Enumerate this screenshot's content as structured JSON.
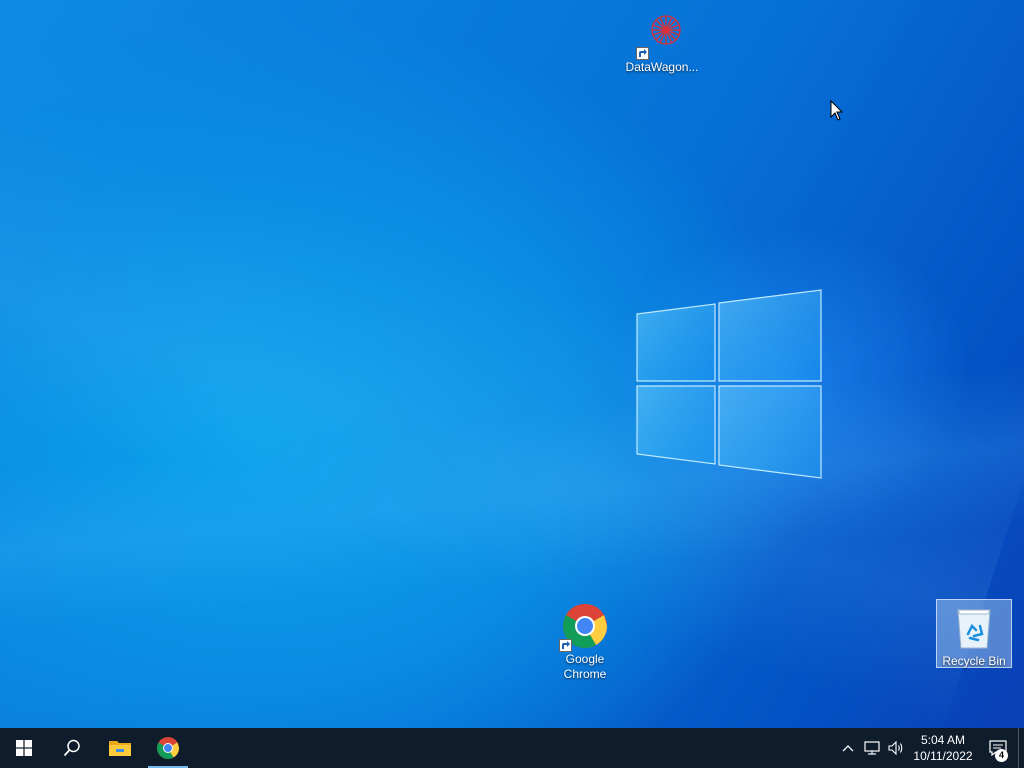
{
  "desktop": {
    "icons": {
      "datawagon": {
        "label": "DataWagon..."
      },
      "chrome": {
        "label_line1": "Google",
        "label_line2": "Chrome"
      },
      "recycle_bin": {
        "label": "Recycle Bin"
      }
    }
  },
  "taskbar": {
    "pinned": [
      "start-icon",
      "search-icon",
      "file-explorer-icon",
      "chrome-icon"
    ],
    "tray": {
      "icons": [
        "chevron-up-icon",
        "network-icon",
        "volume-icon"
      ],
      "time": "5:04 AM",
      "date": "10/11/2022",
      "notification_count": "4"
    }
  },
  "colors": {
    "taskbar_bg": "#0f1c2c",
    "active_indicator": "#76b9ed",
    "wallpaper_primary": "#0a8ee3"
  }
}
